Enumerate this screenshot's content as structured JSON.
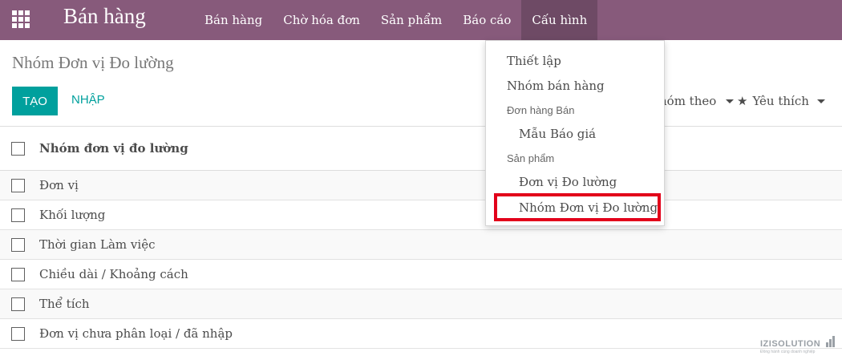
{
  "navbar": {
    "brand": "Bán hàng",
    "menu": [
      {
        "label": "Bán hàng"
      },
      {
        "label": "Chờ hóa đơn"
      },
      {
        "label": "Sản phẩm"
      },
      {
        "label": "Báo cáo"
      },
      {
        "label": "Cấu hình"
      }
    ]
  },
  "control_panel": {
    "breadcrumb": "Nhóm Đơn vị Đo lường",
    "create_label": "TẠO",
    "import_label": "NHẬP",
    "groupby_label": "hóm theo",
    "favorites_label": "Yêu thích"
  },
  "list": {
    "column_header": "Nhóm đơn vị đo lường",
    "rows": [
      {
        "name": "Đơn vị"
      },
      {
        "name": "Khối lượng"
      },
      {
        "name": "Thời gian Làm việc"
      },
      {
        "name": "Chiều dài / Khoảng cách"
      },
      {
        "name": "Thể tích"
      },
      {
        "name": "Đơn vị chưa phân loại / đã nhập"
      }
    ]
  },
  "dropdown": {
    "item_settings": "Thiết lập",
    "item_sales_teams": "Nhóm bán hàng",
    "header_sales_orders": "Đơn hàng Bán",
    "item_quotation_templates": "Mẫu Báo giá",
    "header_products": "Sản phẩm",
    "item_uom": "Đơn vị Đo lường",
    "item_uom_categories": "Nhóm Đơn vị Đo lường"
  },
  "watermark": {
    "brand": "IZISOLUTION",
    "tagline": "Đồng hành cùng doanh nghiệp"
  },
  "colors": {
    "navbar": "#875a7b",
    "navbar_active": "#6e4a65",
    "primary": "#00a09d",
    "highlight_border": "#e2001a"
  }
}
